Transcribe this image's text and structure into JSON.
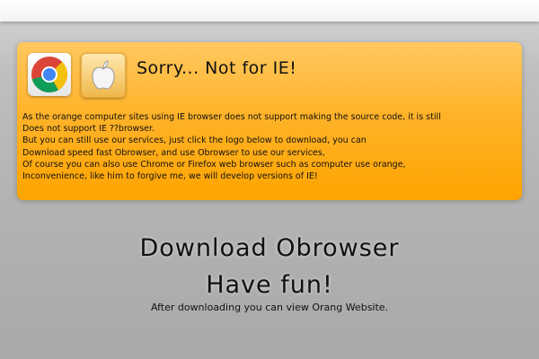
{
  "notice": {
    "title": "Sorry... Not for IE!",
    "lines": [
      "As the orange computer sites using IE browser does not support making the source code, it is still",
      "Does not support IE ??browser.",
      "But you can still use our services, just click the logo below to download, you can",
      "Download speed fast Obrowser, and use Obrowser to use our services,",
      "Of course you can also use Chrome or Firefox web browser such as computer use orange,",
      "Inconvenience, like him to forgive me, we will develop versions of IE!"
    ],
    "icons": [
      "chrome-logo-icon",
      "apple-logo-icon"
    ]
  },
  "main": {
    "headline": "Download Obrowser",
    "subheadline": "Have fun!",
    "note": "After downloading you can view Orang Website."
  },
  "colors": {
    "notice_background": "#ffb32a",
    "page_background": "#b3b3b3"
  }
}
